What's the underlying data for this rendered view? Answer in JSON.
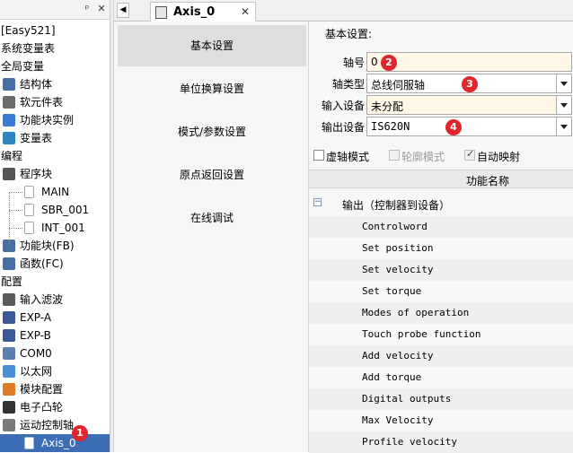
{
  "tree": {
    "header_buttons": [
      "ᵖ",
      "▾",
      "✕"
    ],
    "items": [
      {
        "label": "[Easy521]",
        "level": 0,
        "icon": "none"
      },
      {
        "label": "系统变量表",
        "level": 0,
        "icon": "none"
      },
      {
        "label": "全局变量",
        "level": 0,
        "icon": "none"
      },
      {
        "label": "结构体",
        "level": 1,
        "icon": "struct-icon"
      },
      {
        "label": "软元件表",
        "level": 1,
        "icon": "table-icon"
      },
      {
        "label": "功能块实例",
        "level": 1,
        "icon": "fb-instance-icon"
      },
      {
        "label": "变量表",
        "level": 1,
        "icon": "variable-table-icon"
      },
      {
        "label": "编程",
        "level": 0,
        "icon": "none"
      },
      {
        "label": "程序块",
        "level": 1,
        "icon": "program-block-icon"
      },
      {
        "label": "MAIN",
        "level": 2,
        "icon": "program-file-icon"
      },
      {
        "label": "SBR_001",
        "level": 2,
        "icon": "program-file-icon"
      },
      {
        "label": "INT_001",
        "level": 2,
        "icon": "program-file-icon"
      },
      {
        "label": "功能块(FB)",
        "level": 1,
        "icon": "fb-icon"
      },
      {
        "label": "函数(FC)",
        "level": 1,
        "icon": "fc-icon"
      },
      {
        "label": "配置",
        "level": 0,
        "icon": "none"
      },
      {
        "label": "输入滤波",
        "level": 1,
        "icon": "filter-icon"
      },
      {
        "label": "EXP-A",
        "level": 1,
        "icon": "expansion-icon"
      },
      {
        "label": "EXP-B",
        "level": 1,
        "icon": "expansion-icon"
      },
      {
        "label": "COM0",
        "level": 1,
        "icon": "com-port-icon"
      },
      {
        "label": "以太网",
        "level": 1,
        "icon": "ethernet-icon"
      },
      {
        "label": "模块配置",
        "level": 1,
        "icon": "module-config-icon"
      },
      {
        "label": "电子凸轮",
        "level": 1,
        "icon": "cam-icon"
      },
      {
        "label": "运动控制轴",
        "level": 1,
        "icon": "motion-axis-icon"
      },
      {
        "label": "Axis_0",
        "level": 2,
        "icon": "axis-icon",
        "selected": true
      }
    ],
    "badge": "1"
  },
  "tab": {
    "label": "Axis_0",
    "close": "✕",
    "scroll": "◀"
  },
  "nav": {
    "items": [
      "基本设置",
      "单位换算设置",
      "模式/参数设置",
      "原点返回设置",
      "在线调试"
    ],
    "active_index": 0
  },
  "settings": {
    "title": "基本设置:",
    "fields": [
      {
        "label": "轴号",
        "value": "0",
        "badge": "2",
        "dropdown": false,
        "style": "cream",
        "mono": false
      },
      {
        "label": "轴类型",
        "value": "总线伺服轴",
        "badge": "3",
        "dropdown": true,
        "style": "white",
        "mono": false
      },
      {
        "label": "输入设备",
        "value": "未分配",
        "badge": "",
        "dropdown": true,
        "style": "cream",
        "mono": false
      },
      {
        "label": "输出设备",
        "value": "IS620N",
        "badge": "4",
        "dropdown": true,
        "style": "white",
        "mono": true
      }
    ],
    "checkboxes": [
      {
        "label": "虚轴模式",
        "checked": false,
        "disabled": false
      },
      {
        "label": "轮廓模式",
        "checked": false,
        "disabled": true
      },
      {
        "label": "自动映射",
        "checked": true,
        "disabled": true
      }
    ],
    "function_header": "功能名称",
    "output_group": {
      "expander": "−",
      "label": "输出（控制器到设备）"
    },
    "functions": [
      "Controlword",
      "Set position",
      "Set velocity",
      "Set torque",
      "Modes of operation",
      "Touch probe function",
      "Add velocity",
      "Add torque",
      "Digital outputs",
      "Max Velocity",
      "Profile velocity"
    ]
  }
}
